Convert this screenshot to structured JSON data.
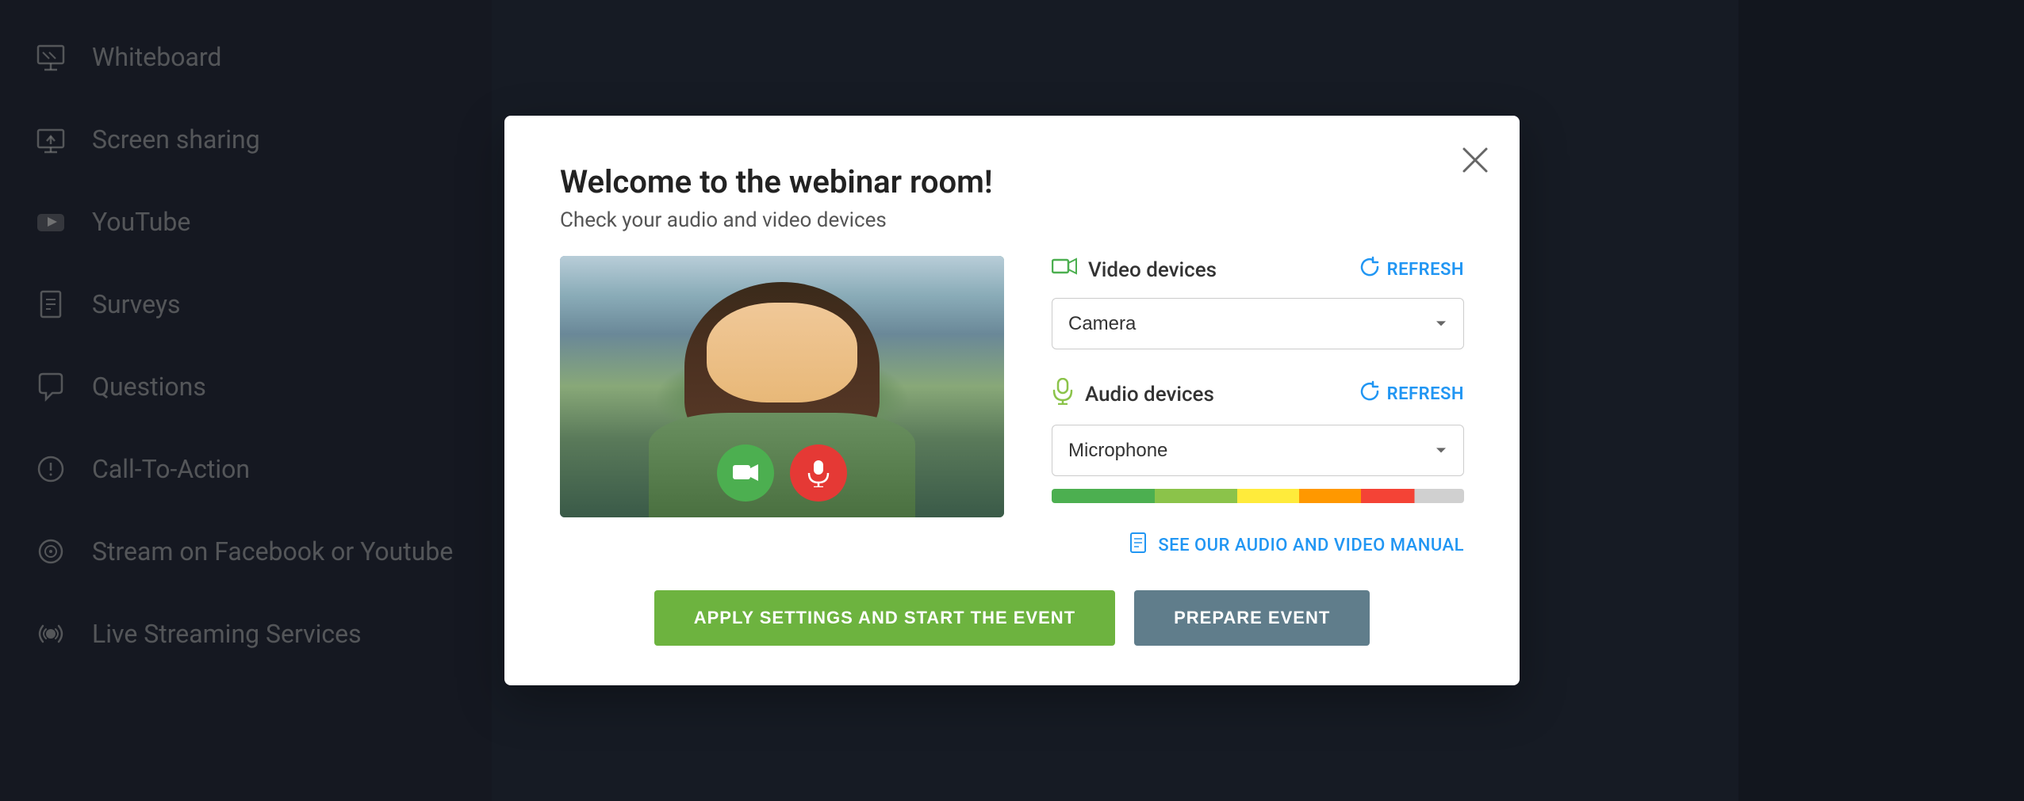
{
  "sidebar": {
    "items": [
      {
        "id": "whiteboard",
        "label": "Whiteboard",
        "icon": "✏️"
      },
      {
        "id": "screen-sharing",
        "label": "Screen sharing",
        "icon": "🖥"
      },
      {
        "id": "youtube",
        "label": "YouTube",
        "icon": "▶"
      },
      {
        "id": "surveys",
        "label": "Surveys",
        "icon": "📋"
      },
      {
        "id": "questions",
        "label": "Questions",
        "icon": "💬"
      },
      {
        "id": "call-to-action",
        "label": "Call-To-Action",
        "icon": "👆"
      },
      {
        "id": "stream-facebook",
        "label": "Stream on Facebook or Youtube",
        "icon": "📡"
      },
      {
        "id": "live-streaming",
        "label": "Live Streaming Services",
        "icon": "🔴"
      }
    ]
  },
  "modal": {
    "title": "Welcome to the webinar room!",
    "subtitle": "Check your audio and video devices",
    "close_label": "×",
    "video_section": {
      "title": "Video devices",
      "refresh_label": "REFRESH",
      "camera_option": "Camera"
    },
    "audio_section": {
      "title": "Audio devices",
      "refresh_label": "REFRESH",
      "microphone_option": "Microphone"
    },
    "manual_link": "SEE OUR AUDIO AND VIDEO MANUAL",
    "btn_apply": "APPLY SETTINGS AND START THE EVENT",
    "btn_prepare": "PREPARE EVENT"
  },
  "video_controls": {
    "camera_icon": "🎥",
    "mic_icon": "🎤"
  }
}
